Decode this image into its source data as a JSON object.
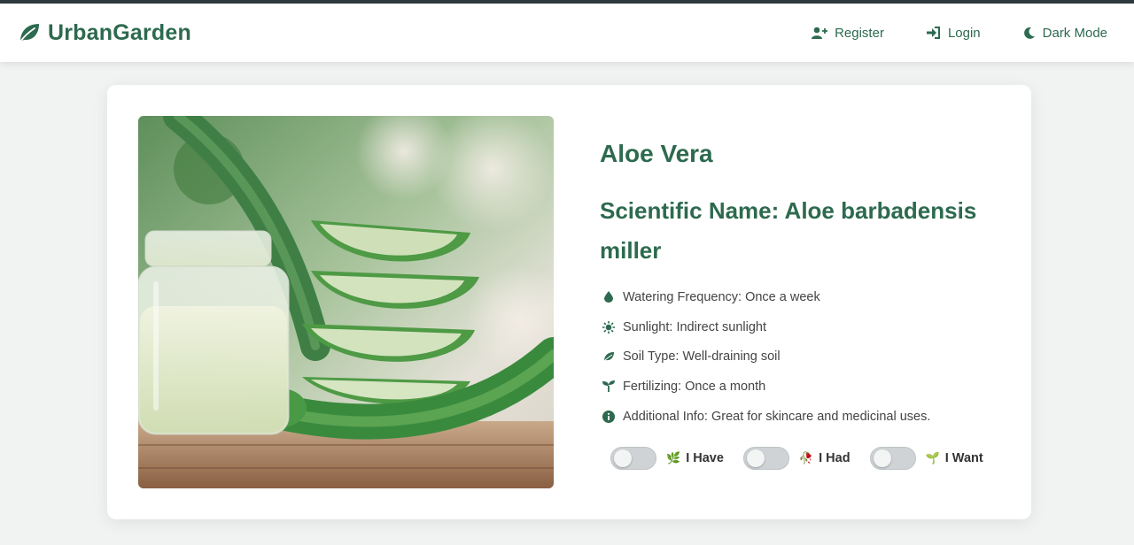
{
  "brand": {
    "name": "UrbanGarden",
    "icon": "leaf-icon"
  },
  "nav": {
    "items": [
      {
        "label": "Register",
        "icon": "user-plus-icon"
      },
      {
        "label": "Login",
        "icon": "sign-in-icon"
      },
      {
        "label": "Dark Mode",
        "icon": "moon-icon"
      }
    ]
  },
  "plant": {
    "name": "Aloe Vera",
    "scientific": "Scientific Name: Aloe barbadensis miller",
    "details": [
      {
        "icon": "droplet-icon",
        "text": "Watering Frequency: Once a week"
      },
      {
        "icon": "sun-icon",
        "text": "Sunlight: Indirect sunlight"
      },
      {
        "icon": "leaf-icon",
        "text": "Soil Type: Well-draining soil"
      },
      {
        "icon": "seedling-icon",
        "text": "Fertilizing: Once a month"
      },
      {
        "icon": "info-icon",
        "text": "Additional Info: Great for skincare and medicinal uses."
      }
    ]
  },
  "toggles": [
    {
      "label": "I Have",
      "emoji": "🌿",
      "on": false
    },
    {
      "label": "I Had",
      "emoji": "🥀",
      "on": false
    },
    {
      "label": "I Want",
      "emoji": "🌱",
      "on": false
    }
  ],
  "colors": {
    "accent": "#2d6a4f",
    "topline": "#2f3a3f",
    "background": "#f1f3f2"
  }
}
